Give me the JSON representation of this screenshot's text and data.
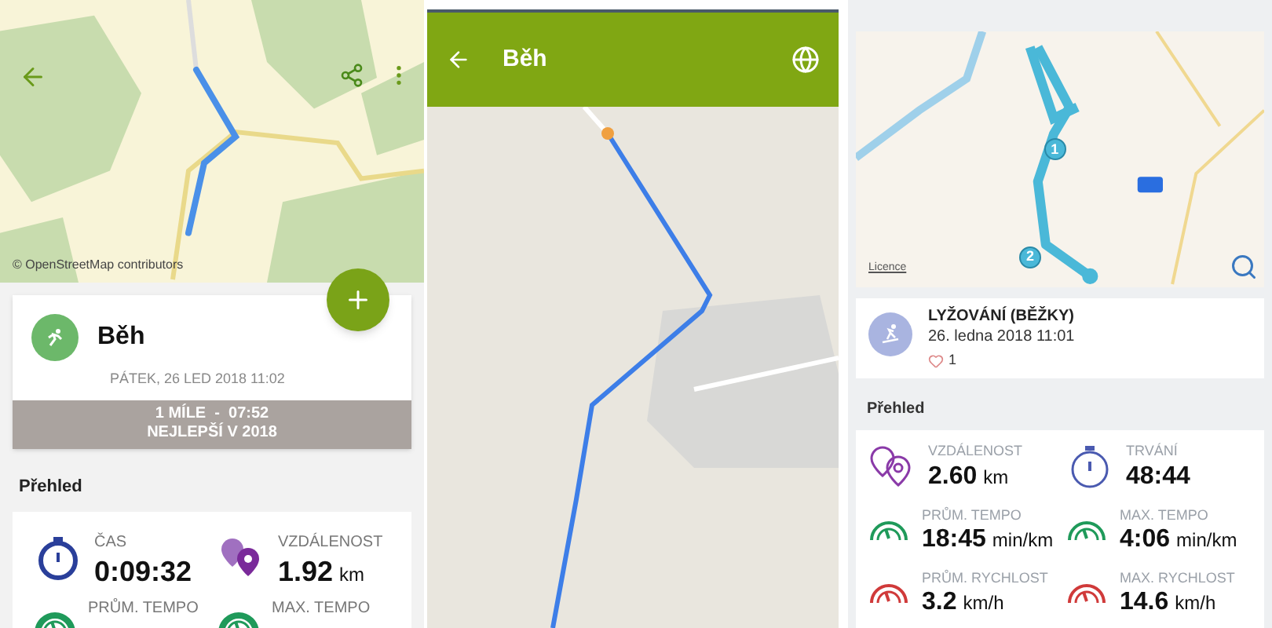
{
  "run_detail": {
    "map": {
      "attribution": "© OpenStreetMap contributors"
    },
    "activity": {
      "title": "Běh",
      "date": "PÁTEK, 26 LED 2018 11:02",
      "record": "1 MÍLE  -  07:52",
      "record_note": "NEJLEPŠÍ V 2018"
    },
    "section_title": "Přehled",
    "stats": [
      {
        "kind": "time",
        "label": "ČAS",
        "value": "0:09:32"
      },
      {
        "kind": "distance",
        "label": "VZDÁLENOST",
        "value": "1.92",
        "unit": "km"
      },
      {
        "kind": "pace",
        "label": "PRŮM. TEMPO"
      },
      {
        "kind": "pace",
        "label": "MAX. TEMPO"
      }
    ]
  },
  "run_map": {
    "title": "Běh"
  },
  "ski_detail": {
    "map": {
      "licence": "Licence",
      "laps": [
        "1",
        "2"
      ]
    },
    "activity": {
      "title": "LYŽOVÁNÍ (BĚŽKY)",
      "date": "26. ledna 2018 11:01",
      "likes": "1"
    },
    "section_title": "Přehled",
    "stats": [
      {
        "kind": "distance",
        "label": "VZDÁLENOST",
        "value": "2.60",
        "unit": "km"
      },
      {
        "kind": "time",
        "label": "TRVÁNÍ",
        "value": "48:44"
      },
      {
        "kind": "pace",
        "label": "PRŮM. TEMPO",
        "value": "18:45",
        "unit": "min/km"
      },
      {
        "kind": "pace",
        "label": "MAX. TEMPO",
        "value": "4:06",
        "unit": "min/km"
      },
      {
        "kind": "speed",
        "label": "PRŮM. RYCHLOST",
        "value": "3.2",
        "unit": "km/h"
      },
      {
        "kind": "speed",
        "label": "MAX. RYCHLOST",
        "value": "14.6",
        "unit": "km/h"
      }
    ]
  }
}
